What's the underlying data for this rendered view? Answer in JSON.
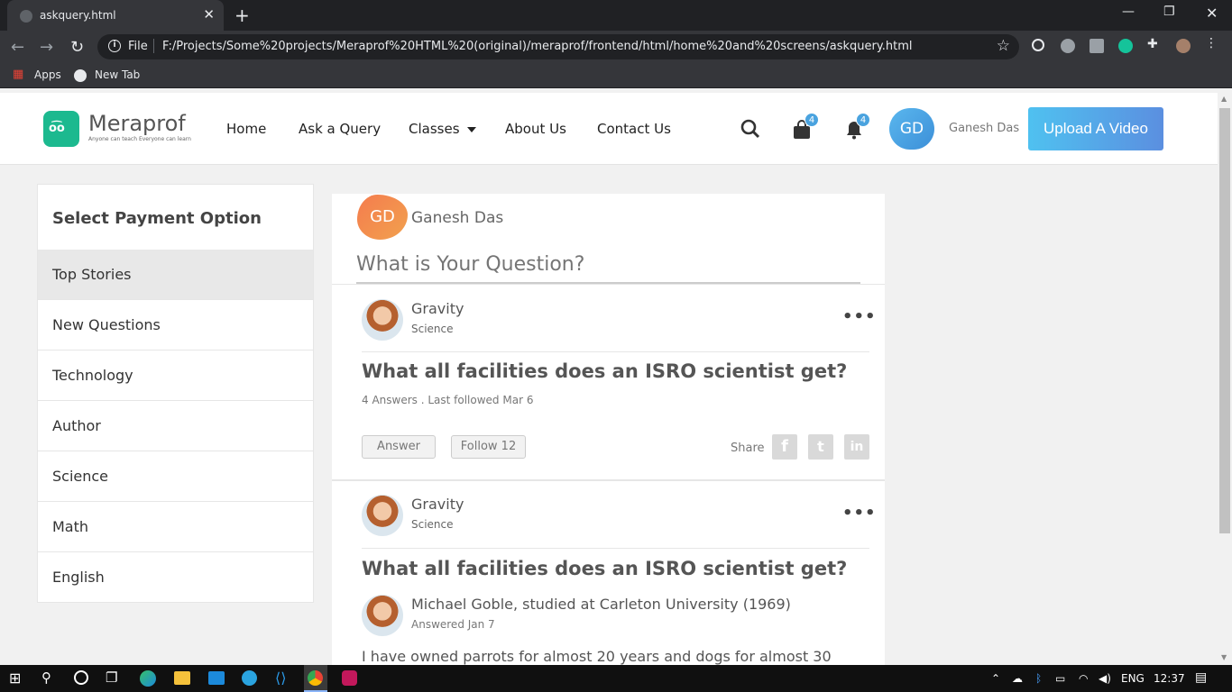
{
  "browser": {
    "tab_title": "askquery.html",
    "file_label": "File",
    "url": "F:/Projects/Some%20projects/Meraprof%20HTML%20(original)/meraprof/frontend/html/home%20and%20screens/askquery.html",
    "bookmarks": [
      "Apps",
      "New Tab"
    ]
  },
  "header": {
    "brand": "Meraprof",
    "tagline": "Anyone can teach Everyone can learn",
    "nav": [
      "Home",
      "Ask a Query",
      "Classes",
      "About Us",
      "Contact Us"
    ],
    "cart_count": "4",
    "notif_count": "4",
    "avatar_initials": "GD",
    "user_name": "Ganesh Das",
    "upload_label": "Upload A Video"
  },
  "sidebar": {
    "title": "Select Payment Option",
    "items": [
      "Top Stories",
      "New Questions",
      "Technology",
      "Author",
      "Science",
      "Math",
      "English"
    ],
    "active": "Top Stories"
  },
  "ask": {
    "initials": "GD",
    "user": "Ganesh Das",
    "placeholder": "What is Your Question?"
  },
  "posts": [
    {
      "topic": "Gravity",
      "subject": "Science",
      "question": "What all facilities does an ISRO scientist get?",
      "meta": "4 Answers . Last followed Mar 6",
      "answer_label": "Answer",
      "follow_label": "Follow 12",
      "share_label": "Share"
    },
    {
      "topic": "Gravity",
      "subject": "Science",
      "question": "What all facilities does an ISRO scientist get?",
      "answerer": "Michael Goble, studied at Carleton University (1969)",
      "answered": "Answered Jan 7",
      "answer_text": "I have owned parrots for almost 20 years and dogs for almost 30"
    }
  ],
  "taskbar": {
    "lang": "ENG",
    "time": "12:37"
  }
}
